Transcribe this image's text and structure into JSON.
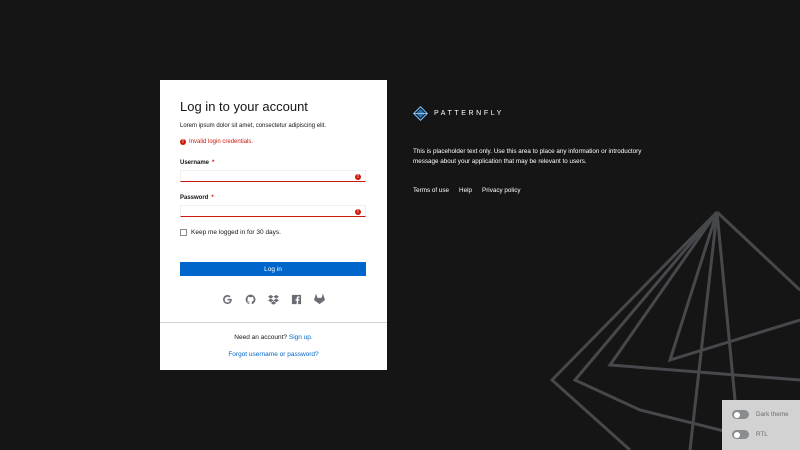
{
  "login": {
    "title": "Log in to your account",
    "subtitle": "Lorem ipsum dolor sit amet, consectetur adipiscing elit.",
    "error": "Invalid login credentials.",
    "username_label": "Username",
    "username_value": "",
    "password_label": "Password",
    "password_value": "",
    "required_mark": "*",
    "error_mark": "!",
    "keep_logged_in": "Keep me logged in for 30 days.",
    "login_button": "Log in",
    "social": [
      "google-icon",
      "github-icon",
      "dropbox-icon",
      "facebook-icon",
      "gitlab-icon"
    ],
    "need_account": "Need an account?",
    "sign_up": "Sign up.",
    "forgot": "Forgot username or password?"
  },
  "brand": {
    "name": "PATTERNFLY",
    "info": "This is placeholder text only. Use this area to place any information or introductory message about your application that may be relevant to users.",
    "links": [
      "Terms of use",
      "Help",
      "Privacy policy"
    ]
  },
  "theme_panel": {
    "dark_theme": "Dark theme",
    "rtl": "RTL"
  },
  "colors": {
    "background": "#151515",
    "primary": "#0066cc",
    "danger": "#c9190b",
    "brand_accent": "#73bcf7"
  }
}
